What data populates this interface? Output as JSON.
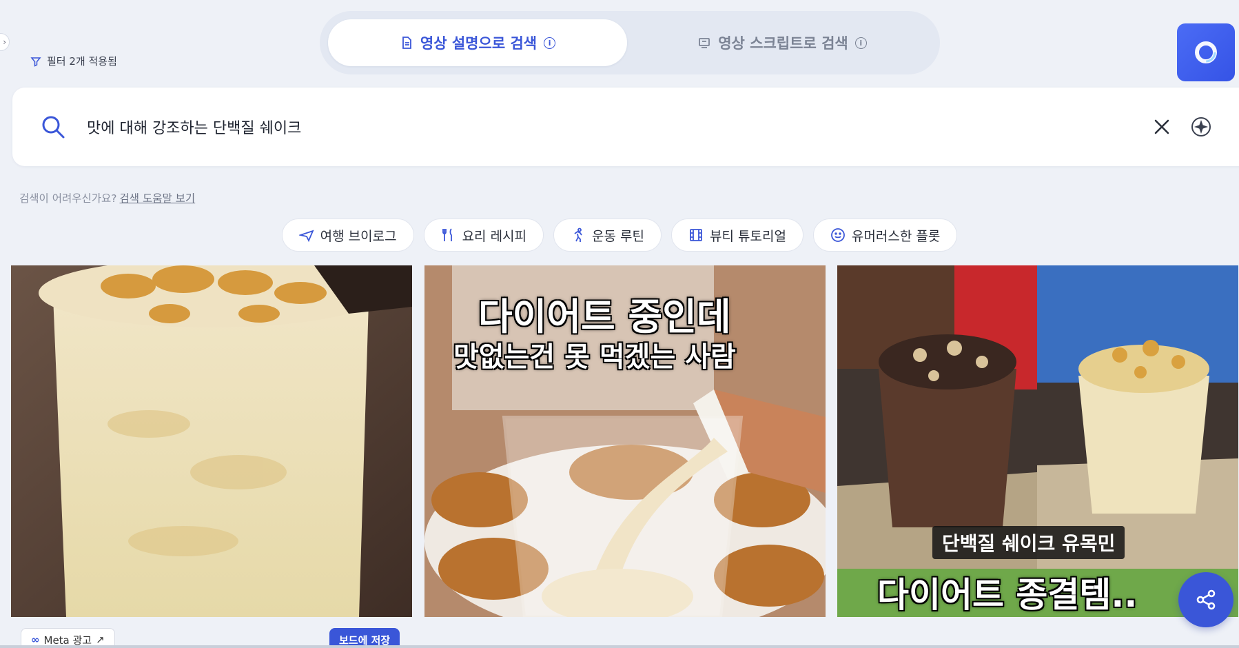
{
  "filter": {
    "label": "필터 2개 적용됨"
  },
  "mode_tabs": [
    {
      "label": "영상 설명으로 검색",
      "active": true
    },
    {
      "label": "영상 스크립트로 검색",
      "active": false
    }
  ],
  "info_glyph": "i",
  "search": {
    "value": "맛에 대해 강조하는 단백질 쉐이크",
    "placeholder": ""
  },
  "help": {
    "text": "검색이 어려우신가요?",
    "link": "검색 도움말 보기"
  },
  "chips": [
    {
      "label": "여행 브이로그",
      "icon": "airplane-icon"
    },
    {
      "label": "요리 레시피",
      "icon": "utensils-icon"
    },
    {
      "label": "운동 루틴",
      "icon": "running-icon"
    },
    {
      "label": "뷰티 튜토리얼",
      "icon": "film-icon"
    },
    {
      "label": "유머러스한 플롯",
      "icon": "smile-icon"
    }
  ],
  "results": [
    {
      "overlay": [],
      "meta_label": "Meta 광고",
      "save_label": "보드에 저장"
    },
    {
      "overlay": [
        "다이어트 중인데",
        "맛없는건 못 먹겠는 사람"
      ]
    },
    {
      "overlay": [
        "단백질 쉐이크 유목민",
        "다이어트 종결템.."
      ]
    }
  ],
  "colors": {
    "accent": "#3a56d8",
    "page_bg": "#eef1f7"
  }
}
